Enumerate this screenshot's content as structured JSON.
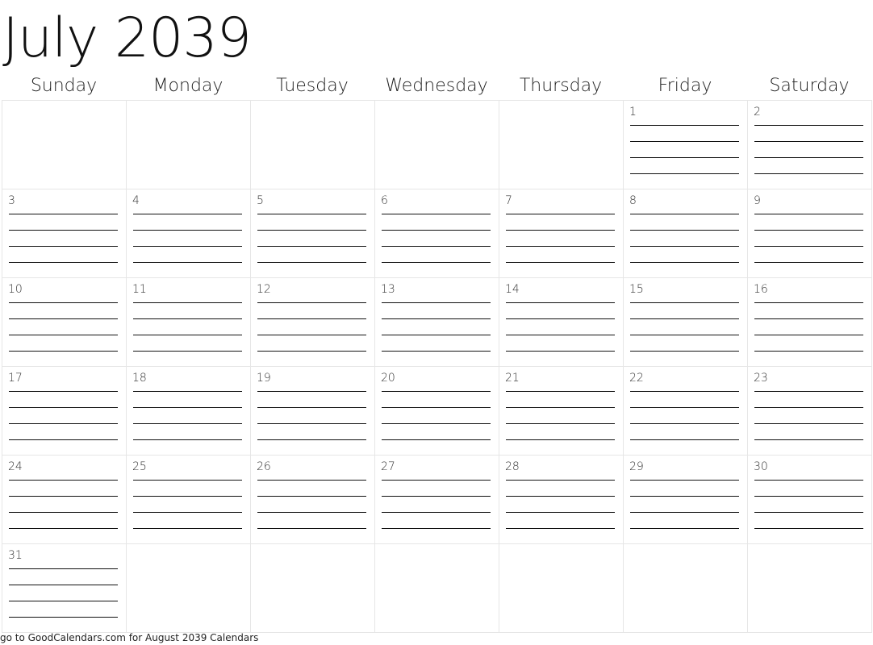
{
  "title": "July 2039",
  "days_of_week": [
    "Sunday",
    "Monday",
    "Tuesday",
    "Wednesday",
    "Thursday",
    "Friday",
    "Saturday"
  ],
  "weeks": [
    [
      "",
      "",
      "",
      "",
      "",
      "1",
      "2"
    ],
    [
      "3",
      "4",
      "5",
      "6",
      "7",
      "8",
      "9"
    ],
    [
      "10",
      "11",
      "12",
      "13",
      "14",
      "15",
      "16"
    ],
    [
      "17",
      "18",
      "19",
      "20",
      "21",
      "22",
      "23"
    ],
    [
      "24",
      "25",
      "26",
      "27",
      "28",
      "29",
      "30"
    ],
    [
      "31",
      "",
      "",
      "",
      "",
      "",
      ""
    ]
  ],
  "footer": "go to GoodCalendars.com for August 2039 Calendars"
}
